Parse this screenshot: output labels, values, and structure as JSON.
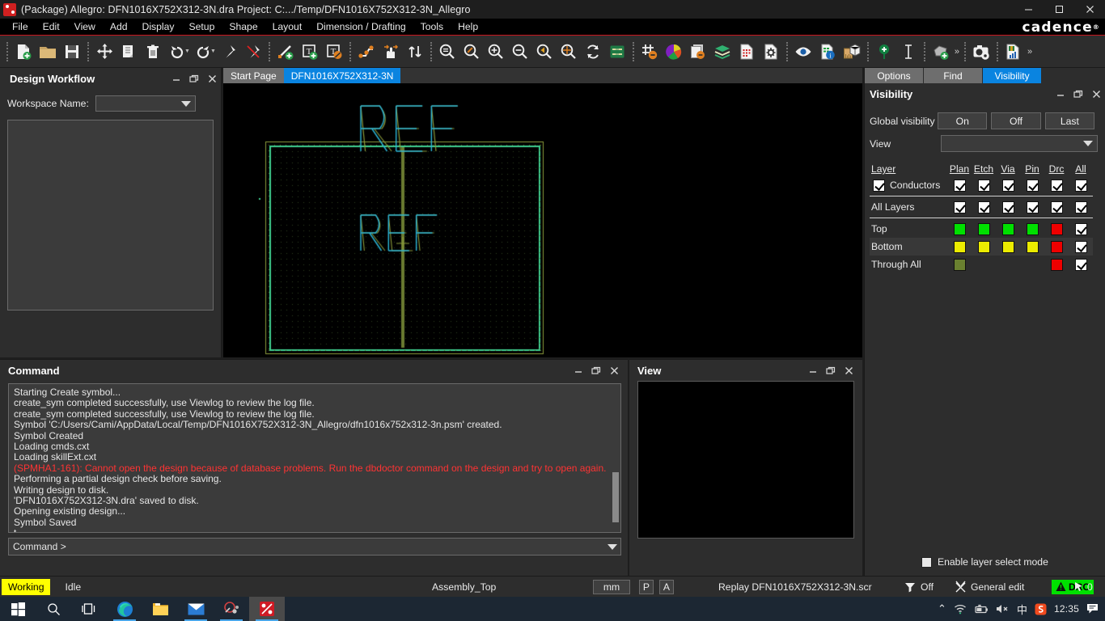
{
  "window": {
    "title": "(Package) Allegro: DFN1016X752X312-3N.dra   Project: C:.../Temp/DFN1016X752X312-3N_Allegro",
    "app_icon": "cadence-allegro-icon",
    "minimize": "—",
    "maximize": "❐",
    "close": "✕",
    "brand": "cadence",
    "brand_mark": "®"
  },
  "menu": {
    "items": [
      {
        "label": "File"
      },
      {
        "label": "Edit"
      },
      {
        "label": "View"
      },
      {
        "label": "Add"
      },
      {
        "label": "Display"
      },
      {
        "label": "Setup"
      },
      {
        "label": "Shape"
      },
      {
        "label": "Layout"
      },
      {
        "label": "Dimension / Drafting"
      },
      {
        "label": "Tools"
      },
      {
        "label": "Help"
      }
    ]
  },
  "toolbar": {
    "groups": [
      {
        "icons": [
          "new-document-icon",
          "open-folder-icon",
          "save-icon"
        ]
      },
      {
        "icons": [
          "move-icon",
          "copy-icon",
          "delete-trash-icon",
          "undo-icon",
          "redo-icon",
          "pin-icon",
          "unpin-icon"
        ]
      },
      {
        "icons": [
          "add-line-icon",
          "add-text-icon",
          "edit-text-icon"
        ]
      },
      {
        "icons": [
          "add-connect-icon",
          "slide-icon",
          "swap-icon"
        ]
      },
      {
        "icons": [
          "zoom-fit-icon",
          "zoom-by-points-icon",
          "zoom-in-icon",
          "zoom-out-icon",
          "zoom-previous-icon",
          "zoom-center-icon",
          "refresh-icon",
          "board-icon"
        ]
      },
      {
        "icons": [
          "grid-toggle-icon",
          "color-palette-icon",
          "subclass-icon",
          "layers-icon",
          "reports-icon",
          "properties-icon"
        ]
      },
      {
        "icons": [
          "visibility-eye-icon",
          "db-info-icon",
          "measure-3d-icon"
        ]
      },
      {
        "icons": [
          "add-pin-icon",
          "text-cursor-icon"
        ]
      },
      {
        "icons": [
          "add-shape-icon"
        ]
      },
      {
        "icons": [
          "screenshot-icon"
        ]
      },
      {
        "icons": [
          "analysis-chart-icon"
        ]
      }
    ],
    "overflow_glyph": "»"
  },
  "design_workflow": {
    "title": "Design Workflow",
    "minimize": "—",
    "restore": "❐",
    "close": "✕",
    "workspace_label": "Workspace Name:",
    "workspace_value": "",
    "workspace_placeholder": ""
  },
  "canvas": {
    "tabs": [
      {
        "label": "Start Page",
        "active": false
      },
      {
        "label": "DFN1016X752X312-3N",
        "active": true
      }
    ],
    "silkscreen_text": "REF",
    "assembly_text": "REF",
    "colors": {
      "outline_green": "#3fcf8f",
      "place_bound": "#8a9a3a",
      "text_cyan": "#2bb6d8",
      "text_olive": "#8a9a3a",
      "background": "#000000"
    }
  },
  "visibility": {
    "tabs": [
      {
        "label": "Options",
        "active": false
      },
      {
        "label": "Find",
        "active": false
      },
      {
        "label": "Visibility",
        "active": true
      }
    ],
    "title": "Visibility",
    "minimize": "—",
    "restore": "❐",
    "close": "✕",
    "global_visibility_label": "Global visibility",
    "global_buttons": [
      "On",
      "Off",
      "Last"
    ],
    "view_label": "View",
    "view_value": "",
    "columns": [
      "Layer",
      "Plan",
      "Etch",
      "Via",
      "Pin",
      "Drc",
      "All"
    ],
    "rows": [
      {
        "name": "Conductors",
        "has_name_checkbox": true,
        "name_checked": true,
        "cells": [
          {
            "type": "check",
            "checked": true
          },
          {
            "type": "check",
            "checked": true
          },
          {
            "type": "check",
            "checked": true
          },
          {
            "type": "check",
            "checked": true
          },
          {
            "type": "check",
            "checked": true
          },
          {
            "type": "check",
            "checked": true
          }
        ],
        "shaded": false
      },
      {
        "name": "All Layers",
        "has_name_checkbox": false,
        "cells": [
          {
            "type": "check",
            "checked": true
          },
          {
            "type": "check",
            "checked": true
          },
          {
            "type": "check",
            "checked": true
          },
          {
            "type": "check",
            "checked": true
          },
          {
            "type": "check",
            "checked": true
          },
          {
            "type": "check",
            "checked": true
          }
        ],
        "shaded": false
      },
      {
        "name": "Top",
        "has_name_checkbox": false,
        "cells": [
          {
            "type": "swatch",
            "color": "#00e000"
          },
          {
            "type": "swatch",
            "color": "#00e000"
          },
          {
            "type": "swatch",
            "color": "#00e000"
          },
          {
            "type": "swatch",
            "color": "#00e000"
          },
          {
            "type": "swatch",
            "color": "#ee0000"
          },
          {
            "type": "check",
            "checked": true
          }
        ],
        "shaded": false
      },
      {
        "name": "Bottom",
        "has_name_checkbox": false,
        "cells": [
          {
            "type": "swatch",
            "color": "#ecec00"
          },
          {
            "type": "swatch",
            "color": "#ecec00"
          },
          {
            "type": "swatch",
            "color": "#ecec00"
          },
          {
            "type": "swatch",
            "color": "#ecec00"
          },
          {
            "type": "swatch",
            "color": "#ee0000"
          },
          {
            "type": "check",
            "checked": true
          }
        ],
        "shaded": true
      },
      {
        "name": "Through All",
        "has_name_checkbox": false,
        "cells": [
          {
            "type": "swatch",
            "color": "#6a8030"
          },
          {
            "type": "blank"
          },
          {
            "type": "blank"
          },
          {
            "type": "blank"
          },
          {
            "type": "swatch",
            "color": "#ee0000"
          },
          {
            "type": "check",
            "checked": true
          }
        ],
        "shaded": false
      }
    ],
    "enable_layer_select_label": "Enable layer select mode",
    "enable_layer_select_checked": false
  },
  "command": {
    "title": "Command",
    "minimize": "—",
    "restore": "❐",
    "close": "✕",
    "log": [
      {
        "text": "Starting Create symbol...",
        "error": false
      },
      {
        "text": "create_sym completed successfully, use Viewlog to review the log file.",
        "error": false
      },
      {
        "text": "create_sym completed successfully, use Viewlog to review the log file.",
        "error": false
      },
      {
        "text": "Symbol 'C:/Users/Cami/AppData/Local/Temp/DFN1016X752X312-3N_Allegro/dfn1016x752x312-3n.psm' created.",
        "error": false
      },
      {
        "text": "Symbol Created",
        "error": false
      },
      {
        "text": "Loading cmds.cxt",
        "error": false
      },
      {
        "text": "Loading skillExt.cxt",
        "error": false
      },
      {
        "text": "(SPMHA1-161): Cannot open the design because of database problems. Run the dbdoctor command on the design and try to open again.",
        "error": true
      },
      {
        "text": "Performing a partial design check before saving.",
        "error": false
      },
      {
        "text": "Writing design to disk.",
        "error": false
      },
      {
        "text": "'DFN1016X752X312-3N.dra' saved to disk.",
        "error": false
      },
      {
        "text": "Opening existing design...",
        "error": false
      },
      {
        "text": "Symbol Saved",
        "error": false
      },
      {
        "text": "t",
        "error": false
      }
    ],
    "prompt": "Command >",
    "input_value": ""
  },
  "view_panel": {
    "title": "View",
    "minimize": "—",
    "restore": "❐",
    "close": "✕"
  },
  "statusbar": {
    "working": "Working",
    "state": "Idle",
    "active_subclass": "Assembly_Top",
    "units": "mm",
    "p_button": "P",
    "a_button": "A",
    "replay": "Replay DFN1016X752X312-3N.scr",
    "filter_icon": "filter-icon",
    "filter_label": "Off",
    "edit_icon": "general-edit-icon",
    "edit_label": "General edit",
    "drc_icon": "warning-triangle-icon",
    "drc_label": "DRC",
    "drc_color": "#00e000",
    "cursor_icon": "cursor-arrow-icon",
    "cursor_count": "0"
  },
  "taskbar": {
    "items": [
      {
        "name": "start-button",
        "icon": "windows-logo-icon"
      },
      {
        "name": "search-button",
        "icon": "search-icon"
      },
      {
        "name": "task-view-button",
        "icon": "task-view-icon"
      },
      {
        "name": "edge-button",
        "icon": "edge-browser-icon",
        "running": true
      },
      {
        "name": "file-explorer-button",
        "icon": "folder-icon",
        "running": false
      },
      {
        "name": "mail-button",
        "icon": "mail-envelope-icon",
        "running": true
      },
      {
        "name": "tool-button",
        "icon": "gear-tool-icon",
        "running": true
      },
      {
        "name": "allegro-button",
        "icon": "cadence-allegro-icon",
        "running": true,
        "active": true
      }
    ],
    "tray": {
      "chevron": "⌃",
      "wifi_icon": "wifi-icon",
      "battery_icon": "battery-icon",
      "volume_icon": "volume-muted-icon",
      "ime_label": "中",
      "sogou_icon": "sogou-ime-icon",
      "clock": "12:35",
      "notifications_icon": "notification-icon"
    }
  }
}
